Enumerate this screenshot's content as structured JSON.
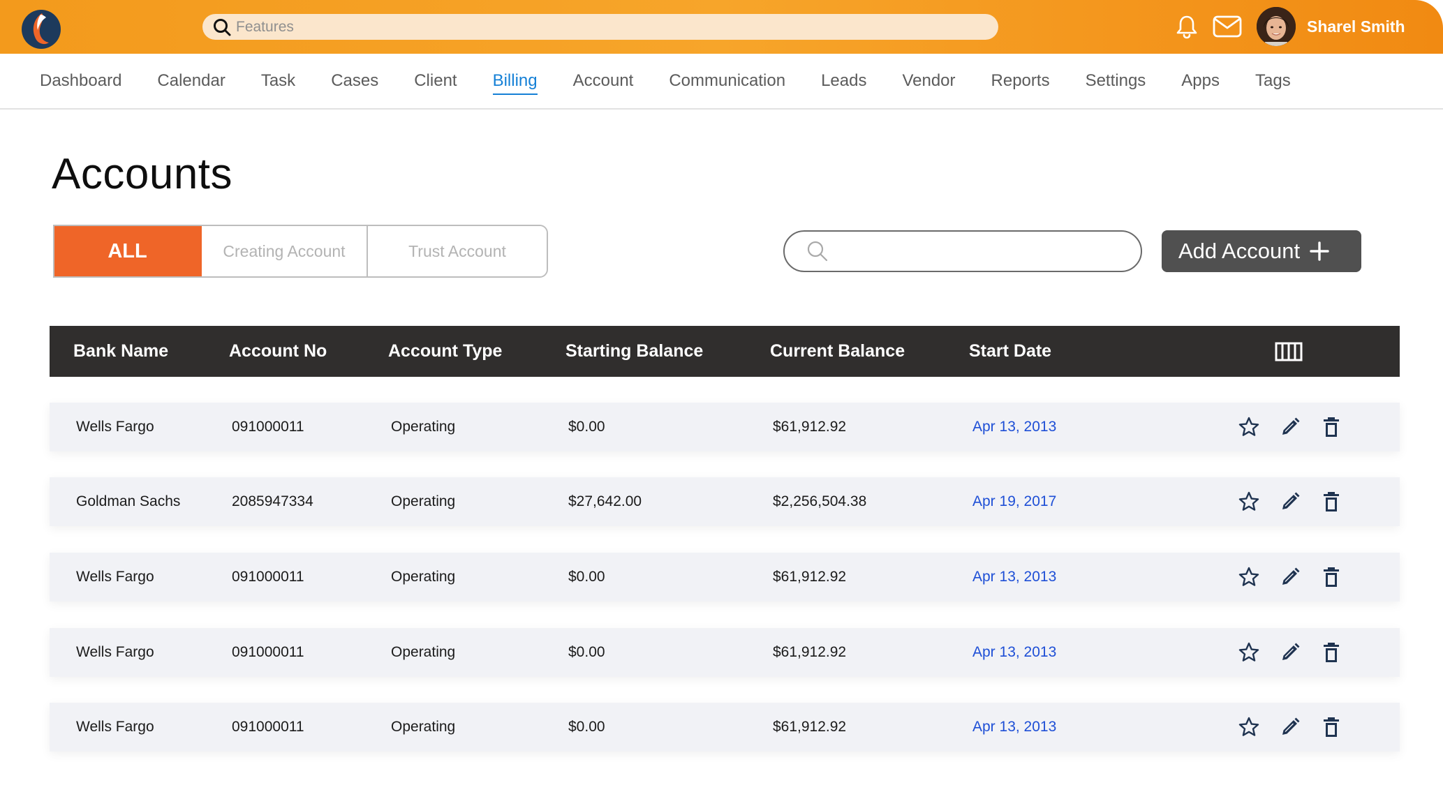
{
  "header": {
    "search_placeholder": "Features",
    "user_name": "Sharel Smith"
  },
  "nav": {
    "items": [
      {
        "label": "Dashboard",
        "active": false
      },
      {
        "label": "Calendar",
        "active": false
      },
      {
        "label": "Task",
        "active": false
      },
      {
        "label": "Cases",
        "active": false
      },
      {
        "label": "Client",
        "active": false
      },
      {
        "label": "Billing",
        "active": true
      },
      {
        "label": "Account",
        "active": false
      },
      {
        "label": "Communication",
        "active": false
      },
      {
        "label": "Leads",
        "active": false
      },
      {
        "label": "Vendor",
        "active": false
      },
      {
        "label": "Reports",
        "active": false
      },
      {
        "label": "Settings",
        "active": false
      },
      {
        "label": "Apps",
        "active": false
      },
      {
        "label": "Tags",
        "active": false
      }
    ]
  },
  "page": {
    "title": "Accounts",
    "filters": [
      "ALL",
      "Creating Account",
      "Trust Account"
    ],
    "active_filter": "ALL",
    "search_placeholder": "",
    "add_button_label": "Add Account"
  },
  "table": {
    "columns": [
      "Bank Name",
      "Account No",
      "Account Type",
      "Starting Balance",
      "Current Balance",
      "Start Date"
    ],
    "rows": [
      {
        "bank": "Wells Fargo",
        "account_no": "091000011",
        "type": "Operating",
        "starting": "$0.00",
        "current": "$61,912.92",
        "date": "Apr 13, 2013"
      },
      {
        "bank": "Goldman Sachs",
        "account_no": "2085947334",
        "type": "Operating",
        "starting": "$27,642.00",
        "current": "$2,256,504.38",
        "date": "Apr 19, 2017"
      },
      {
        "bank": "Wells Fargo",
        "account_no": "091000011",
        "type": "Operating",
        "starting": "$0.00",
        "current": "$61,912.92",
        "date": "Apr 13, 2013"
      },
      {
        "bank": "Wells Fargo",
        "account_no": "091000011",
        "type": "Operating",
        "starting": "$0.00",
        "current": "$61,912.92",
        "date": "Apr 13, 2013"
      },
      {
        "bank": "Wells Fargo",
        "account_no": "091000011",
        "type": "Operating",
        "starting": "$0.00",
        "current": "$61,912.92",
        "date": "Apr 13, 2013"
      }
    ]
  },
  "icons": {
    "logo": "app-logo",
    "search": "search-icon",
    "notifications": "bell-icon",
    "messages": "mail-icon",
    "add": "plus-icon",
    "columns": "columns-icon",
    "row_actions": [
      "star-icon",
      "edit-pencil-icon",
      "trash-icon"
    ]
  },
  "colors": {
    "header_orange": "#f39a1c",
    "active_tab": "#ef6528",
    "active_nav": "#1580d6",
    "table_header": "#302e2d",
    "date_link": "#1e4fd6",
    "action_icon": "#1f3350"
  }
}
